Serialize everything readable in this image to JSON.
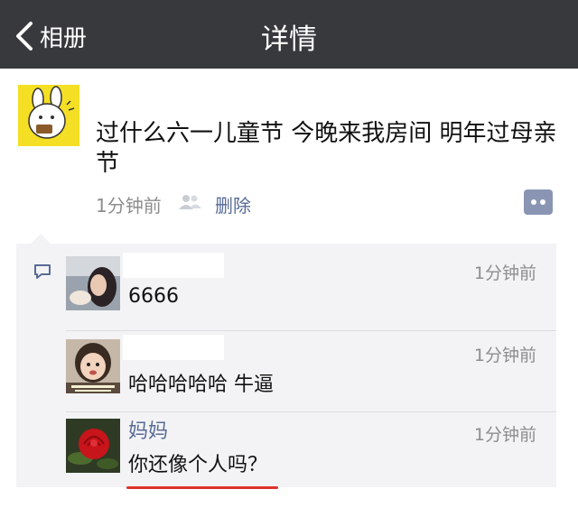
{
  "navbar": {
    "back_label": "相册",
    "title": "详情"
  },
  "post": {
    "text": "过什么六一儿童节 今晚来我房间 明年过母亲节",
    "time": "1分钟前",
    "delete_label": "删除"
  },
  "comments": [
    {
      "name": "",
      "text": "6666",
      "time": "1分钟前"
    },
    {
      "name": "",
      "text": "哈哈哈哈哈 牛逼",
      "time": "1分钟前"
    },
    {
      "name": "妈妈",
      "text": "你还像个人吗？",
      "time": "1分钟前"
    }
  ],
  "colors": {
    "navbar": "#38393d",
    "link": "#576b95",
    "comment_bg": "#f3f3f5",
    "underline": "#e0322c"
  }
}
